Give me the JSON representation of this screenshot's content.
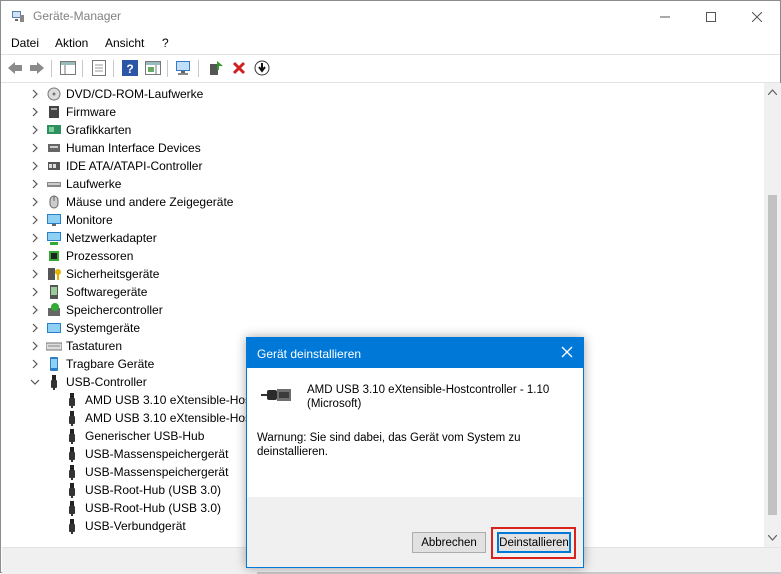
{
  "window": {
    "title": "Geräte-Manager"
  },
  "menu": {
    "items": [
      "Datei",
      "Aktion",
      "Ansicht",
      "?"
    ]
  },
  "tree": {
    "categories": [
      {
        "label": "DVD/CD-ROM-Laufwerke",
        "icon": "dvd-drive-icon"
      },
      {
        "label": "Firmware",
        "icon": "firmware-icon"
      },
      {
        "label": "Grafikkarten",
        "icon": "display-adapter-icon"
      },
      {
        "label": "Human Interface Devices",
        "icon": "hid-icon"
      },
      {
        "label": "IDE ATA/ATAPI-Controller",
        "icon": "ide-controller-icon"
      },
      {
        "label": "Laufwerke",
        "icon": "disk-drive-icon"
      },
      {
        "label": "Mäuse und andere Zeigegeräte",
        "icon": "mouse-icon"
      },
      {
        "label": "Monitore",
        "icon": "monitor-icon"
      },
      {
        "label": "Netzwerkadapter",
        "icon": "network-adapter-icon"
      },
      {
        "label": "Prozessoren",
        "icon": "processor-icon"
      },
      {
        "label": "Sicherheitsgeräte",
        "icon": "security-device-icon"
      },
      {
        "label": "Softwaregeräte",
        "icon": "software-device-icon"
      },
      {
        "label": "Speichercontroller",
        "icon": "storage-controller-icon"
      },
      {
        "label": "Systemgeräte",
        "icon": "system-device-icon"
      },
      {
        "label": "Tastaturen",
        "icon": "keyboard-icon"
      },
      {
        "label": "Tragbare Geräte",
        "icon": "portable-device-icon"
      },
      {
        "label": "USB-Controller",
        "icon": "usb-controller-icon"
      }
    ],
    "usb_children": [
      "AMD USB 3.10 eXtensible-Hostcontroller - 1.10 (Microsoft)",
      "AMD USB 3.10 eXtensible-Hostcontroller - 1.10 (Microsoft)",
      "Generischer USB-Hub",
      "USB-Massenspeichergerät",
      "USB-Massenspeichergerät",
      "USB-Root-Hub (USB 3.0)",
      "USB-Root-Hub (USB 3.0)",
      "USB-Verbundgerät"
    ]
  },
  "dialog": {
    "title": "Gerät deinstallieren",
    "device_name": "AMD USB 3.10 eXtensible-Hostcontroller - 1.10 (Microsoft)",
    "warning": "Warnung: Sie sind dabei, das Gerät vom System zu deinstallieren.",
    "cancel_label": "Abbrechen",
    "uninstall_label": "Deinstallieren"
  },
  "colors": {
    "accent": "#0078d7",
    "highlight": "#d9211d"
  }
}
